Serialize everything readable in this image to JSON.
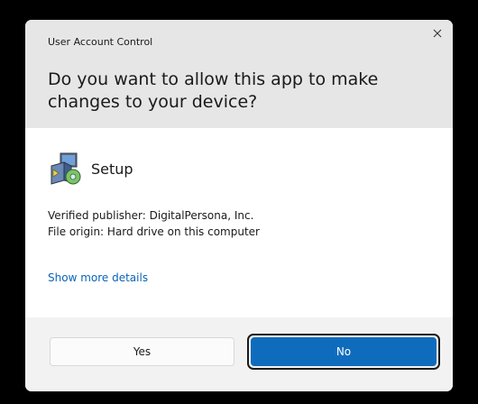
{
  "dialog": {
    "window_title": "User Account Control",
    "question": "Do you want to allow this app to make changes to your device?",
    "app": {
      "name": "Setup",
      "icon": "setup-installer-icon"
    },
    "publisher": "Verified publisher: DigitalPersona, Inc.",
    "origin": "File origin: Hard drive on this computer",
    "details_link": "Show more details",
    "buttons": {
      "yes": "Yes",
      "no": "No"
    },
    "colors": {
      "header_bg": "#e6e6e6",
      "footer_bg": "#f2f2f2",
      "accent": "#0f6cbd",
      "link": "#0a63b8"
    }
  }
}
